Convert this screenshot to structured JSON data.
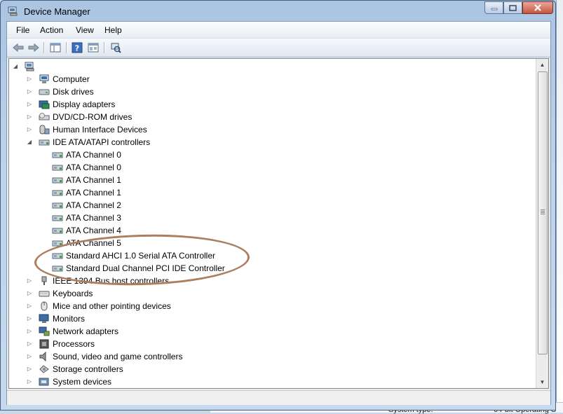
{
  "window": {
    "title": "Device Manager",
    "title_icon": "device-manager-icon"
  },
  "menu": {
    "items": [
      "File",
      "Action",
      "View",
      "Help"
    ]
  },
  "toolbar": {
    "buttons": [
      "back-arrow-icon",
      "forward-arrow-icon",
      "show-hide-tree-icon",
      "help-icon",
      "properties-icon",
      "scan-hardware-icon"
    ]
  },
  "tree": {
    "root_icon": "computer-root-icon",
    "nodes": [
      {
        "label": "Computer",
        "icon": "computer-icon",
        "expanded": false
      },
      {
        "label": "Disk drives",
        "icon": "disk-drive-icon",
        "expanded": false
      },
      {
        "label": "Display adapters",
        "icon": "display-adapter-icon",
        "expanded": false
      },
      {
        "label": "DVD/CD-ROM drives",
        "icon": "dvd-drive-icon",
        "expanded": false
      },
      {
        "label": "Human Interface Devices",
        "icon": "hid-icon",
        "expanded": false
      },
      {
        "label": "IDE ATA/ATAPI controllers",
        "icon": "ide-controller-icon",
        "expanded": true,
        "children": [
          "ATA Channel 0",
          "ATA Channel 0",
          "ATA Channel 1",
          "ATA Channel 1",
          "ATA Channel 2",
          "ATA Channel 3",
          "ATA Channel 4",
          "ATA Channel 5",
          "Standard AHCI 1.0 Serial ATA Controller",
          "Standard Dual Channel PCI IDE Controller"
        ]
      },
      {
        "label": "IEEE 1394 Bus host controllers",
        "icon": "ieee1394-icon",
        "expanded": false
      },
      {
        "label": "Keyboards",
        "icon": "keyboard-icon",
        "expanded": false
      },
      {
        "label": "Mice and other pointing devices",
        "icon": "mouse-icon",
        "expanded": false
      },
      {
        "label": "Monitors",
        "icon": "monitor-icon",
        "expanded": false
      },
      {
        "label": "Network adapters",
        "icon": "network-adapter-icon",
        "expanded": false
      },
      {
        "label": "Processors",
        "icon": "processor-icon",
        "expanded": false
      },
      {
        "label": "Sound, video and game controllers",
        "icon": "sound-icon",
        "expanded": false
      },
      {
        "label": "Storage controllers",
        "icon": "storage-controller-icon",
        "expanded": false
      },
      {
        "label": "System devices",
        "icon": "system-devices-icon",
        "expanded": false
      }
    ]
  },
  "background": {
    "status_left": "System type:",
    "status_right": "64-bit Operating S"
  },
  "colors": {
    "annotation": "#ad7e5e",
    "window_frame": "#bcd3ec"
  }
}
